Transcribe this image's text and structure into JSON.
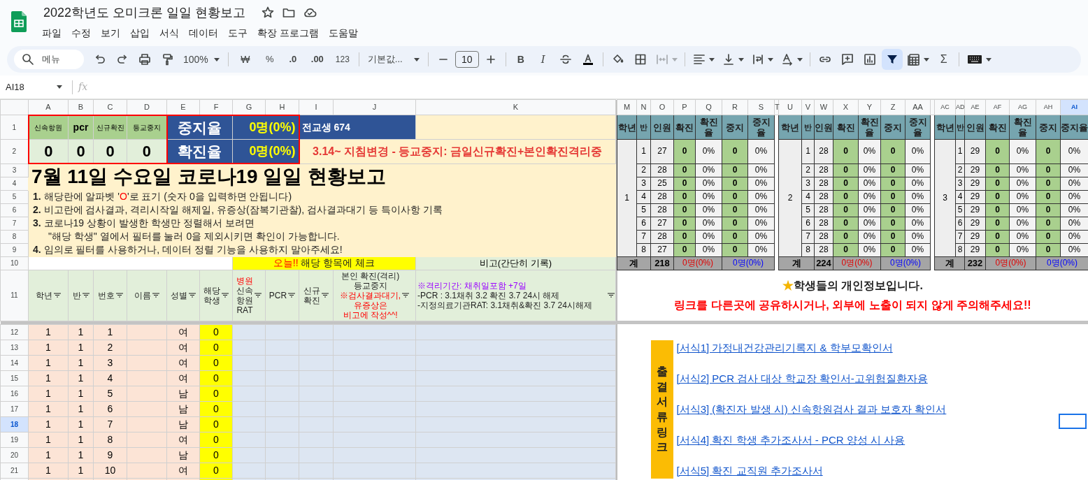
{
  "app": {
    "title": "2022학년도 오미크론 일일 현황보고",
    "menu": [
      "파일",
      "수정",
      "보기",
      "삽입",
      "서식",
      "데이터",
      "도구",
      "확장 프로그램",
      "도움말"
    ]
  },
  "toolbar": {
    "search_placeholder": "메뉴",
    "zoom": "100%",
    "currency": "₩",
    "percent": "%",
    "decrease_decimals": ".0",
    "increase_decimals": ".00",
    "number_format": "123",
    "font": "기본값...",
    "font_size": "10",
    "bold": "B",
    "italic": "I",
    "sum": "Σ",
    "filter_on": true
  },
  "formula_bar": {
    "cell_ref": "AI18",
    "fx": "fx"
  },
  "column_headers": [
    {
      "label": "A",
      "selected": false
    },
    {
      "label": "B",
      "selected": false
    },
    {
      "label": "C",
      "selected": false
    },
    {
      "label": "D",
      "selected": false
    },
    {
      "label": "E",
      "selected": false
    },
    {
      "label": "F",
      "selected": false
    },
    {
      "label": "G",
      "selected": false
    },
    {
      "label": "H",
      "selected": false
    },
    {
      "label": "I",
      "selected": false
    },
    {
      "label": "J",
      "selected": false
    },
    {
      "label": "K",
      "selected": false
    },
    {
      "label": "M",
      "selected": false
    },
    {
      "label": "N",
      "selected": false
    },
    {
      "label": "O",
      "selected": false
    },
    {
      "label": "P",
      "selected": false
    },
    {
      "label": "Q",
      "selected": false
    },
    {
      "label": "R",
      "selected": false
    },
    {
      "label": "S",
      "selected": false
    },
    {
      "label": "T",
      "selected": false
    },
    {
      "label": "U",
      "selected": false
    },
    {
      "label": "V",
      "selected": false
    },
    {
      "label": "W",
      "selected": false
    },
    {
      "label": "X",
      "selected": false
    },
    {
      "label": "Y",
      "selected": false
    },
    {
      "label": "Z",
      "selected": false
    },
    {
      "label": "AA",
      "selected": false
    },
    {
      "label": "AC",
      "selected": false
    },
    {
      "label": "AD",
      "selected": false
    },
    {
      "label": "AE",
      "selected": false
    },
    {
      "label": "AF",
      "selected": false
    },
    {
      "label": "AG",
      "selected": false
    },
    {
      "label": "AH",
      "selected": false
    },
    {
      "label": "AI",
      "selected": true
    }
  ],
  "row_headers": [
    {
      "label": "1",
      "selected": false
    },
    {
      "label": "2",
      "selected": false
    },
    {
      "label": "3",
      "selected": false
    },
    {
      "label": "4",
      "selected": false
    },
    {
      "label": "5",
      "selected": false
    },
    {
      "label": "6",
      "selected": false
    },
    {
      "label": "7",
      "selected": false
    },
    {
      "label": "8",
      "selected": false
    },
    {
      "label": "9",
      "selected": false
    },
    {
      "label": "10",
      "selected": false
    },
    {
      "label": "11",
      "selected": false
    },
    {
      "label": "12",
      "selected": false
    },
    {
      "label": "13",
      "selected": false
    },
    {
      "label": "14",
      "selected": false
    },
    {
      "label": "15",
      "selected": false
    },
    {
      "label": "16",
      "selected": false
    },
    {
      "label": "17",
      "selected": false
    },
    {
      "label": "18",
      "selected": true
    },
    {
      "label": "19",
      "selected": false
    },
    {
      "label": "20",
      "selected": false
    },
    {
      "label": "21",
      "selected": false
    }
  ],
  "summary": {
    "labels": [
      "신속항원",
      "pcr",
      "신규확진",
      "등교중지"
    ],
    "values": [
      "0",
      "0",
      "0",
      "0"
    ],
    "rates": [
      {
        "label": "중지율",
        "value": "0명(0%)"
      },
      {
        "label": "확진율",
        "value": "0명(0%)"
      }
    ],
    "total_students": "전교생 674",
    "notice": "3.14~ 지침변경 - 등교중지: 금일신규확진+본인확진격리중"
  },
  "report": {
    "title": "7월 11일 수요일 코로나19 일일 현황보고",
    "lines": [
      {
        "indented": false,
        "parts": [
          {
            "text": "**1.** 해당란에 알파벳 '",
            "highlight": false
          },
          {
            "text": "O",
            "highlight": true
          },
          {
            "text": "'로 표기 (숫자 0을 입력하면 안됩니다)",
            "highlight": false
          }
        ]
      },
      {
        "indented": false,
        "parts": [
          {
            "text": "**2.** 비고란에 검사결과, 격리시작일 해제일, 유증상(잠복기관찰), 검사결과대기 등 특이사항 기록",
            "highlight": false
          }
        ]
      },
      {
        "indented": false,
        "parts": [
          {
            "text": "**3.** 코로나19 상황이 발생한 학생만 정렬해서 보려면",
            "highlight": false
          }
        ]
      },
      {
        "indented": true,
        "parts": [
          {
            "text": "\"해당 학생\" 열에서 필터를 눌러 0을 제외시키면 확인이 가능합니다.",
            "highlight": false
          }
        ]
      },
      {
        "indented": false,
        "parts": [
          {
            "text": "**4.** 임의로 필터를 사용하거나, 데이터 정렬 기능을 사용하지 말아주세요!",
            "highlight": false
          }
        ]
      }
    ]
  },
  "check_banner": [
    {
      "text": "오늘!!",
      "highlight": true
    },
    {
      "text": " 해당 항목에 체크",
      "highlight": false
    }
  ],
  "remarks_heading": "비고(간단히 기록)",
  "column_titles": [
    {
      "parts": [
        {
          "text": "학년",
          "kind": "plain"
        }
      ]
    },
    {
      "parts": [
        {
          "text": "반",
          "kind": "plain"
        }
      ]
    },
    {
      "parts": [
        {
          "text": "번호",
          "kind": "plain"
        }
      ]
    },
    {
      "parts": [
        {
          "text": "이름",
          "kind": "plain"
        }
      ]
    },
    {
      "parts": [
        {
          "text": "성별",
          "kind": "plain"
        }
      ]
    },
    {
      "parts": [
        {
          "text": "해당",
          "kind": "plain"
        },
        {
          "text": "학생",
          "kind": "plain"
        }
      ]
    },
    {
      "parts": [
        {
          "text": "병원",
          "kind": "warning"
        },
        {
          "text": "신속",
          "kind": "plain"
        },
        {
          "text": "항원",
          "kind": "plain"
        },
        {
          "text": "RAT",
          "kind": "plain"
        }
      ]
    },
    {
      "parts": [
        {
          "text": "PCR",
          "kind": "plain"
        }
      ]
    },
    {
      "parts": [
        {
          "text": "신규",
          "kind": "plain"
        },
        {
          "text": "확진",
          "kind": "plain"
        }
      ]
    },
    {
      "parts": [
        {
          "text": "본인 확진(격리)",
          "kind": "plain"
        },
        {
          "text": "등교중지",
          "kind": "plain"
        },
        {
          "text": "※검사결과대기,",
          "kind": "warning"
        },
        {
          "text": "유증상은",
          "kind": "warning"
        },
        {
          "text": "비고에 작성^^!",
          "kind": "warning"
        }
      ]
    },
    {
      "parts": [
        {
          "text": "※격리기간: 채취일포함 +7일",
          "kind": "note"
        },
        {
          "text": "-PCR : 3.1채취 3.2 확진 3.7 24시 해제",
          "kind": "plain"
        },
        {
          "text": "-지정의료기관RAT: 3.1채취&확진 3.7 24시해제",
          "kind": "plain"
        }
      ]
    }
  ],
  "students": [
    {
      "grade": "1",
      "class": "1",
      "number": "1",
      "gender": "여",
      "target": "0"
    },
    {
      "grade": "1",
      "class": "1",
      "number": "2",
      "gender": "여",
      "target": "0"
    },
    {
      "grade": "1",
      "class": "1",
      "number": "3",
      "gender": "여",
      "target": "0"
    },
    {
      "grade": "1",
      "class": "1",
      "number": "4",
      "gender": "여",
      "target": "0"
    },
    {
      "grade": "1",
      "class": "1",
      "number": "5",
      "gender": "남",
      "target": "0"
    },
    {
      "grade": "1",
      "class": "1",
      "number": "6",
      "gender": "남",
      "target": "0"
    },
    {
      "grade": "1",
      "class": "1",
      "number": "7",
      "gender": "남",
      "target": "0"
    },
    {
      "grade": "1",
      "class": "1",
      "number": "8",
      "gender": "여",
      "target": "0"
    },
    {
      "grade": "1",
      "class": "1",
      "number": "9",
      "gender": "남",
      "target": "0"
    },
    {
      "grade": "1",
      "class": "1",
      "number": "10",
      "gender": "여",
      "target": "0"
    }
  ],
  "grades": [
    {
      "headers": [
        "학년",
        "반",
        "인원",
        "확진",
        "확진율",
        "중지",
        "중지율"
      ],
      "grade": "1",
      "classes": [
        {
          "class": "1",
          "count": "27",
          "confirmed": "0",
          "confirmed_rate": "0%",
          "stopped": "0",
          "stopped_rate": "0%"
        },
        {
          "class": "2",
          "count": "28",
          "confirmed": "0",
          "confirmed_rate": "0%",
          "stopped": "0",
          "stopped_rate": "0%"
        },
        {
          "class": "3",
          "count": "25",
          "confirmed": "0",
          "confirmed_rate": "0%",
          "stopped": "0",
          "stopped_rate": "0%"
        },
        {
          "class": "4",
          "count": "28",
          "confirmed": "0",
          "confirmed_rate": "0%",
          "stopped": "0",
          "stopped_rate": "0%"
        },
        {
          "class": "5",
          "count": "28",
          "confirmed": "0",
          "confirmed_rate": "0%",
          "stopped": "0",
          "stopped_rate": "0%"
        },
        {
          "class": "6",
          "count": "27",
          "confirmed": "0",
          "confirmed_rate": "0%",
          "stopped": "0",
          "stopped_rate": "0%"
        },
        {
          "class": "7",
          "count": "28",
          "confirmed": "0",
          "confirmed_rate": "0%",
          "stopped": "0",
          "stopped_rate": "0%"
        },
        {
          "class": "8",
          "count": "27",
          "confirmed": "0",
          "confirmed_rate": "0%",
          "stopped": "0",
          "stopped_rate": "0%"
        }
      ],
      "total_label": "계",
      "total_count": "218",
      "confirmed_total": "0명(0%)",
      "stopped_total": "0명(0%)"
    },
    {
      "headers": [
        "학년",
        "반",
        "인원",
        "확진",
        "확진율",
        "중지",
        "중지율"
      ],
      "grade": "2",
      "classes": [
        {
          "class": "1",
          "count": "28",
          "confirmed": "0",
          "confirmed_rate": "0%",
          "stopped": "0",
          "stopped_rate": "0%"
        },
        {
          "class": "2",
          "count": "28",
          "confirmed": "0",
          "confirmed_rate": "0%",
          "stopped": "0",
          "stopped_rate": "0%"
        },
        {
          "class": "3",
          "count": "28",
          "confirmed": "0",
          "confirmed_rate": "0%",
          "stopped": "0",
          "stopped_rate": "0%"
        },
        {
          "class": "4",
          "count": "28",
          "confirmed": "0",
          "confirmed_rate": "0%",
          "stopped": "0",
          "stopped_rate": "0%"
        },
        {
          "class": "5",
          "count": "28",
          "confirmed": "0",
          "confirmed_rate": "0%",
          "stopped": "0",
          "stopped_rate": "0%"
        },
        {
          "class": "6",
          "count": "28",
          "confirmed": "0",
          "confirmed_rate": "0%",
          "stopped": "0",
          "stopped_rate": "0%"
        },
        {
          "class": "7",
          "count": "28",
          "confirmed": "0",
          "confirmed_rate": "0%",
          "stopped": "0",
          "stopped_rate": "0%"
        },
        {
          "class": "8",
          "count": "28",
          "confirmed": "0",
          "confirmed_rate": "0%",
          "stopped": "0",
          "stopped_rate": "0%"
        }
      ],
      "total_label": "계",
      "total_count": "224",
      "confirmed_total": "0명(0%)",
      "stopped_total": "0명(0%)"
    },
    {
      "headers": [
        "학년",
        "반",
        "인원",
        "확진",
        "확진율",
        "중지",
        "중지율"
      ],
      "grade": "3",
      "classes": [
        {
          "class": "1",
          "count": "29",
          "confirmed": "0",
          "confirmed_rate": "0%",
          "stopped": "0",
          "stopped_rate": "0%"
        },
        {
          "class": "2",
          "count": "29",
          "confirmed": "0",
          "confirmed_rate": "0%",
          "stopped": "0",
          "stopped_rate": "0%"
        },
        {
          "class": "3",
          "count": "29",
          "confirmed": "0",
          "confirmed_rate": "0%",
          "stopped": "0",
          "stopped_rate": "0%"
        },
        {
          "class": "4",
          "count": "29",
          "confirmed": "0",
          "confirmed_rate": "0%",
          "stopped": "0",
          "stopped_rate": "0%"
        },
        {
          "class": "5",
          "count": "29",
          "confirmed": "0",
          "confirmed_rate": "0%",
          "stopped": "0",
          "stopped_rate": "0%"
        },
        {
          "class": "6",
          "count": "29",
          "confirmed": "0",
          "confirmed_rate": "0%",
          "stopped": "0",
          "stopped_rate": "0%"
        },
        {
          "class": "7",
          "count": "29",
          "confirmed": "0",
          "confirmed_rate": "0%",
          "stopped": "0",
          "stopped_rate": "0%"
        },
        {
          "class": "8",
          "count": "29",
          "confirmed": "0",
          "confirmed_rate": "0%",
          "stopped": "0",
          "stopped_rate": "0%"
        }
      ],
      "total_label": "계",
      "total_count": "232",
      "confirmed_total": "0명(0%)",
      "stopped_total": "0명(0%)"
    }
  ],
  "privacy_notice": {
    "icon": "★",
    "text": "학생들의 개인정보입니다.",
    "warning": "링크를 다른곳에 공유하시거나, 외부에 노출이 되지 않게 주의해주세요!!"
  },
  "forms": {
    "label": "출결서류링크",
    "links": [
      "[서식1] 가정내건강관리기록지 & 학부모확인서",
      "[서식2] PCR 검사 대상 학교장 확인서-고위험질환자용",
      "[서식3] (확진자 발생 시) 신속항원검사 결과 보호자 확인서",
      "[서식4] 확진 학생 추가조사서 - PCR 양성 시 사용",
      "[서식5] 확진 교직원 추가조사서"
    ]
  }
}
